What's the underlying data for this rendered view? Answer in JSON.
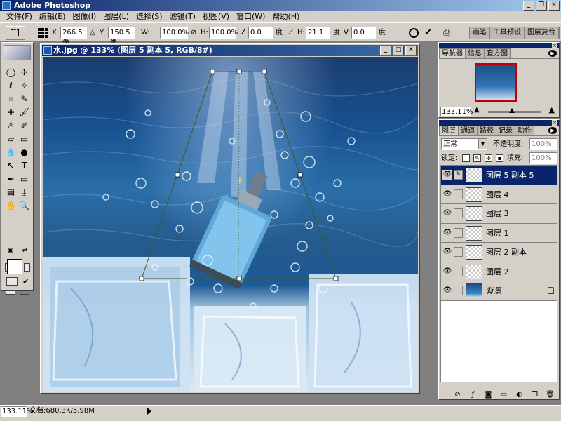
{
  "app": {
    "title": "Adobe Photoshop"
  },
  "window_controls": {
    "minimize": "_",
    "restore": "❐",
    "close": "✕"
  },
  "menu": [
    "文件(F)",
    "编辑(E)",
    "图像(I)",
    "图层(L)",
    "选择(S)",
    "滤镜(T)",
    "视图(V)",
    "窗口(W)",
    "帮助(H)"
  ],
  "options": {
    "x_label": "X:",
    "x_value": "266.5 像",
    "y_label": "Y:",
    "y_value": "150.5 像",
    "w_label": "W:",
    "w_value": "100.0%",
    "h_label": "H:",
    "h_value": "100.0%",
    "angle_value": "0.0",
    "angle_unit": "度",
    "hskew_label": "H:",
    "hskew_value": "21.1",
    "hskew_unit": "度",
    "vskew_label": "V:",
    "vskew_value": "0.0",
    "vskew_unit": "度",
    "confirm_icon": "✔",
    "palette_tabs": [
      "画笔",
      "工具预设",
      "图层复合"
    ]
  },
  "document": {
    "title": "水.jpg @ 133% (图层 5 副本 5, RGB/8#)"
  },
  "navigator": {
    "tabs": [
      "导航器",
      "信息",
      "直方图"
    ],
    "zoom": "133.11%"
  },
  "layers_panel": {
    "tabs": [
      "图层",
      "通道",
      "路径",
      "记录",
      "动作"
    ],
    "blend_mode": "正常",
    "opacity_label": "不透明度:",
    "opacity_value": "100%",
    "lock_label": "锁定:",
    "fill_label": "填充:",
    "fill_value": "100%",
    "layers": [
      {
        "name": "图层 5 副本 5",
        "selected": true
      },
      {
        "name": "图层 4"
      },
      {
        "name": "图层 3"
      },
      {
        "name": "图层 1"
      },
      {
        "name": "图层 2 副本"
      },
      {
        "name": "图层 2"
      },
      {
        "name": "背景",
        "locked": true
      }
    ]
  },
  "status": {
    "zoom": "133.11%",
    "doc_info": "文档:680.3K/5.98M"
  },
  "colors": {
    "titlebar": "#0a246a",
    "chrome": "#d4d0c8",
    "foreground": "#ffffff",
    "background_swatch": "#3b1208"
  }
}
